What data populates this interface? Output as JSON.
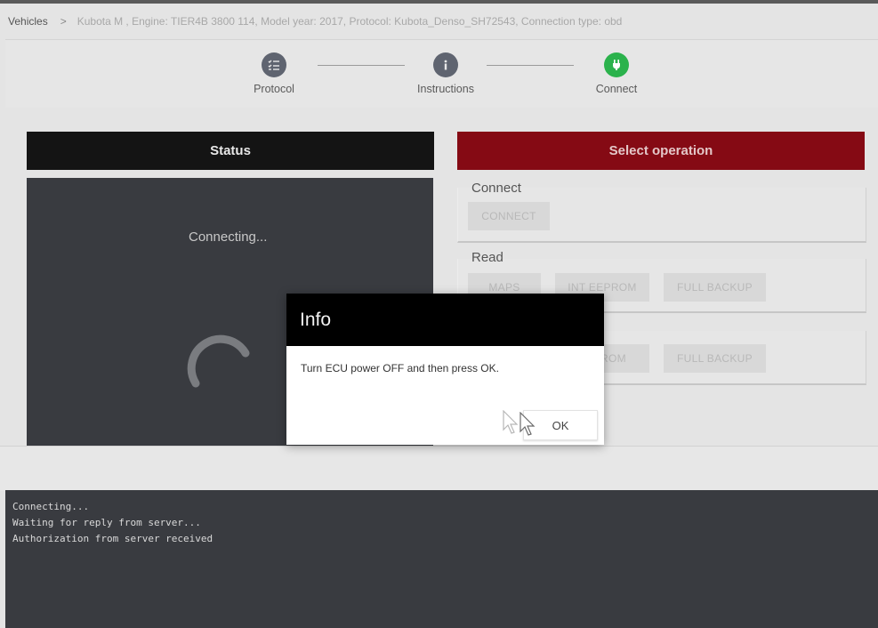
{
  "breadcrumb": {
    "root": "Vehicles",
    "separator": ">",
    "detail": "Kubota M , Engine: TIER4B 3800 114, Model year: 2017, Protocol: Kubota_Denso_SH72543, Connection type: obd"
  },
  "stepper": {
    "steps": [
      {
        "label": "Protocol",
        "icon": "checklist-icon",
        "color": "#5f6470"
      },
      {
        "label": "Instructions",
        "icon": "info-icon",
        "color": "#5f6470"
      },
      {
        "label": "Connect",
        "icon": "plug-icon",
        "color": "#2bb24c"
      }
    ]
  },
  "status": {
    "header": "Status",
    "connecting": "Connecting..."
  },
  "operations": {
    "header": "Select operation",
    "header_color": "#850a14",
    "sections": [
      {
        "title": "Connect",
        "buttons": [
          "CONNECT"
        ]
      },
      {
        "title": "Read",
        "buttons": [
          "MAPS",
          "INT EEPROM",
          "FULL BACKUP"
        ]
      },
      {
        "title": "",
        "buttons": [
          "EEPROM",
          "FULL BACKUP"
        ]
      }
    ]
  },
  "console": {
    "lines": [
      "Connecting...",
      "Waiting for reply from server...",
      "Authorization from server received"
    ]
  },
  "modal": {
    "title": "Info",
    "message": "Turn ECU power OFF and then press OK.",
    "ok_label": "OK"
  }
}
